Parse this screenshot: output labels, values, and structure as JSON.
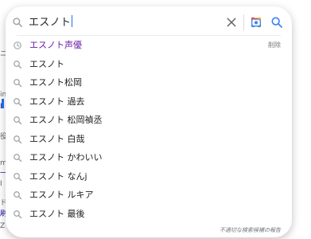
{
  "background": {
    "fragments": [
      "ニ",
      "in",
      "I",
      "役",
      "m",
      "一",
      "I",
      "ド",
      "刷",
      "Z"
    ]
  },
  "search": {
    "value": "エスノト",
    "clear_icon": "close-icon",
    "lens_icon": "google-lens-icon",
    "search_icon": "search-icon"
  },
  "suggestions": [
    {
      "text": "エスノト声優",
      "icon": "history-icon",
      "visited": true,
      "remove_label": "削除"
    },
    {
      "text": "エスノト",
      "icon": "search-icon",
      "visited": false
    },
    {
      "text": "エスノト松岡",
      "icon": "search-icon",
      "visited": false
    },
    {
      "text": "エスノト 過去",
      "icon": "search-icon",
      "visited": false
    },
    {
      "text": "エスノト 松岡禎丞",
      "icon": "search-icon",
      "visited": false
    },
    {
      "text": "エスノト 白哉",
      "icon": "search-icon",
      "visited": false
    },
    {
      "text": "エスノト かわいい",
      "icon": "search-icon",
      "visited": false
    },
    {
      "text": "エスノト なんj",
      "icon": "search-icon",
      "visited": false
    },
    {
      "text": "エスノト ルキア",
      "icon": "search-icon",
      "visited": false
    },
    {
      "text": "エスノト 最後",
      "icon": "search-icon",
      "visited": false
    }
  ],
  "footer": {
    "report_label": "不適切な検索候補の報告"
  },
  "colors": {
    "accent": "#1a73e8",
    "visited": "#681da8",
    "text": "#202124",
    "muted": "#70757a"
  }
}
